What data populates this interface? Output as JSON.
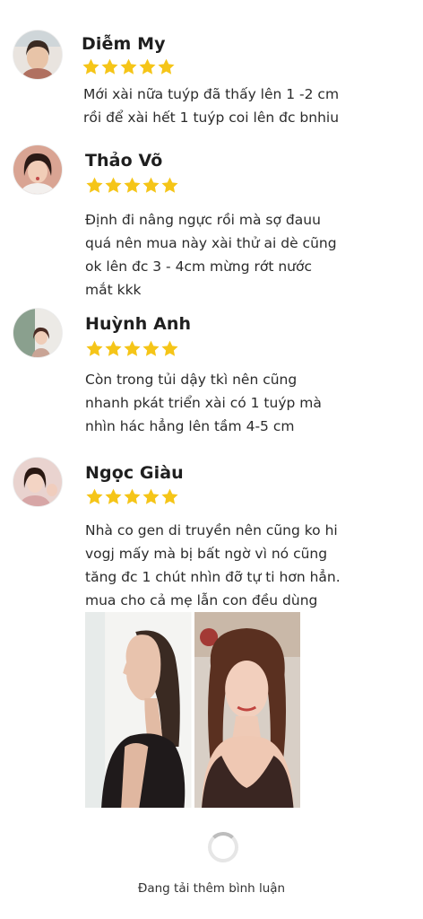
{
  "reviews": [
    {
      "name": "Diễm My",
      "rating": 5,
      "text": "Mới xài nữa tuýp đã thấy lên 1 -2 cm\nrồi để xài hết 1 tuýp coi lên đc bnhiu"
    },
    {
      "name": "Thảo Võ",
      "rating": 5,
      "text": "Định đi nâng ngực rồi mà sợ đauu\nquá nên mua này xài thử ai dè cũng\nok lên đc 3 - 4cm mừng rớt nước\nmắt kkk"
    },
    {
      "name": "Huỳnh Anh",
      "rating": 5,
      "text": "Còn trong tủi dậy tkì nên cũng\nnhanh pkát triển xài có 1 tuýp mà\nnhìn hác hẳng lên tầm 4-5 cm"
    },
    {
      "name": "Ngọc Giàu",
      "rating": 5,
      "text": "Nhà co  gen di truyền nên cũng ko hi\nvogj mấy mà bị bất ngờ vì nó cũng\ntăng đc 1 chút nhìn đỡ tự ti hơn hẳn.\nmua cho cả mẹ lẫn con đều dùng"
    }
  ],
  "footer": {
    "loading_text": "Đang tải thêm bình luận"
  },
  "colors": {
    "star": "#f5c518",
    "text": "#2b2b2b"
  },
  "icons": [
    "star-icon",
    "loading-spinner-icon"
  ]
}
